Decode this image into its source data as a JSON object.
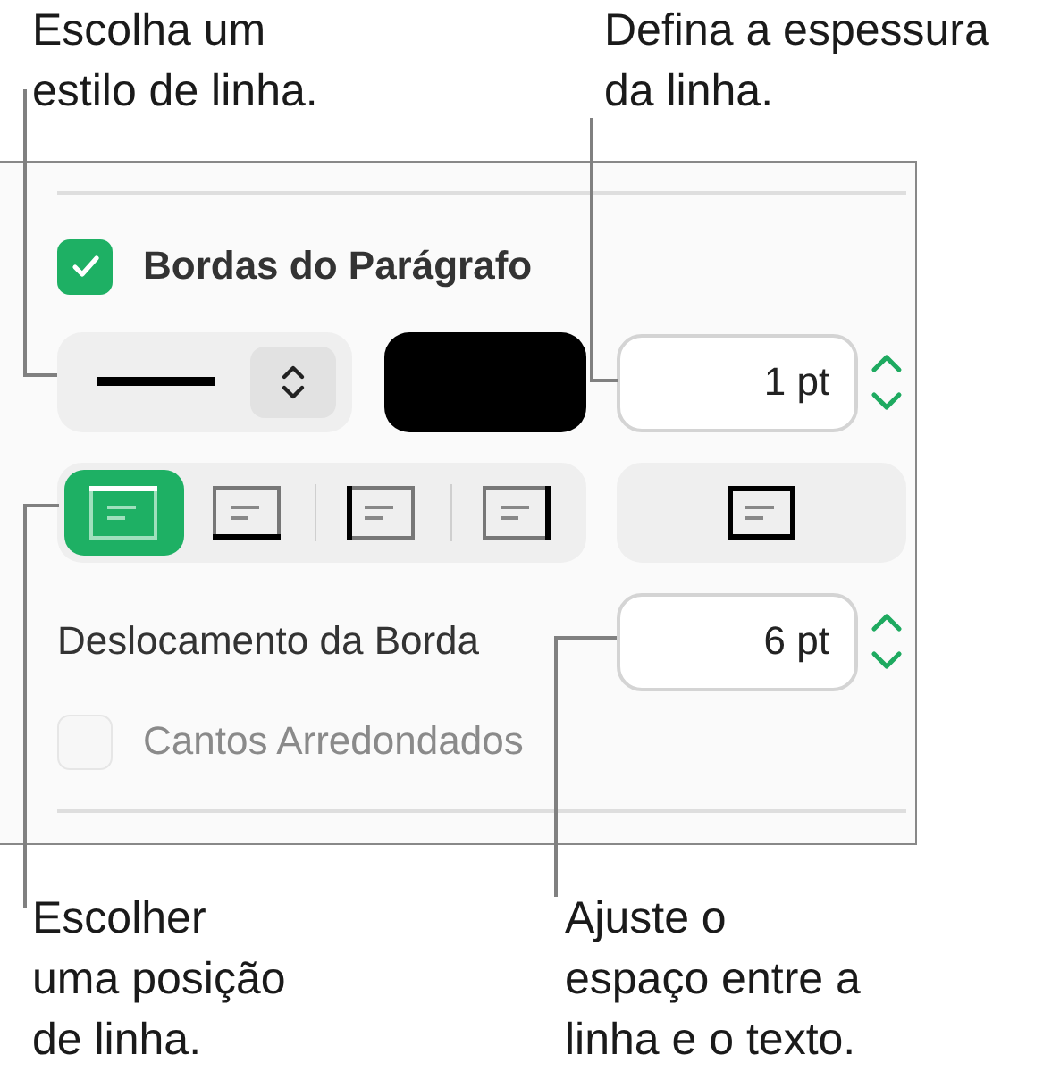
{
  "callouts_top": [
    {
      "text": "Escolha um\nestilo de linha."
    },
    {
      "text": "Defina a espessura\nda linha."
    }
  ],
  "panel": {
    "paragraph_borders": {
      "label": "Bordas do Parágrafo",
      "checked": true
    },
    "color_well": {
      "color": "#000000"
    },
    "thickness": {
      "value": "1 pt"
    },
    "positions": [
      {
        "kind": "top",
        "selected": true
      },
      {
        "kind": "bottom",
        "selected": false
      },
      {
        "kind": "left",
        "selected": false
      },
      {
        "kind": "right",
        "selected": false
      }
    ],
    "outline": {
      "kind": "all",
      "selected": false
    },
    "offset": {
      "label": "Deslocamento da Borda",
      "value": "6 pt"
    },
    "rounded_corners": {
      "label": "Cantos Arredondados",
      "checked": false,
      "disabled": true
    }
  },
  "callouts_bottom": [
    {
      "text": "Escolher\numa posição\nde linha."
    },
    {
      "text": "Ajuste o\nespaço entre a\nlinha e o texto."
    }
  ]
}
